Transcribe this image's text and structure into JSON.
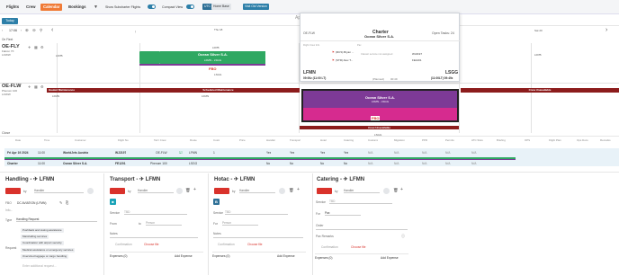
{
  "nav": {
    "tabs": [
      "Flights",
      "Crew",
      "Calendar",
      "Bookings"
    ],
    "active_tab": "Calendar",
    "show_subcharter_label": "Show Subcharter Flights",
    "compact_view_label": "Compact View",
    "utc_label": "UTC",
    "home_base_label": "Home Base",
    "old_version_label": "Visit Old Version"
  },
  "toolbar": {
    "today_label": "Today",
    "time_value": "17:06",
    "month_label": "Apr 2024",
    "on_fleet_label": "On Fleet",
    "day_left": "Thu 18",
    "day_right": "Sat 20",
    "hour_label": "07:00"
  },
  "aircraft": [
    {
      "reg": "OE-FLY",
      "type": "Falcon 7X",
      "base": "LOWW",
      "pax": "14"
    },
    {
      "reg": "OE-FLW",
      "type": "Phenom 100",
      "base": "LOWW",
      "pax": "4"
    }
  ],
  "timeline": {
    "row1": {
      "left_code": "LFPB",
      "bar_label": "Ocean Silver S.A.",
      "bar_sub": "LFMN - LSGG",
      "top_code": "LFPB",
      "fbo_label": "FBO",
      "below_code": "LSGG",
      "right_code": "LFPB",
      "right_small": "LFMN"
    },
    "row2": {
      "maint1": "Hauled Maintenance",
      "maint1_code": "LFMN",
      "maint2": "Scheduled Maintenance",
      "maint2_code": "LFMN",
      "bar_label": "Ocean Silver S.A.",
      "bar_sub": "LFMN - LSGG",
      "fbo_label": "FBO",
      "crew_label": "Crew Unavailable",
      "crew_code": "LSGG",
      "right_bar": "Crew Unavailable"
    }
  },
  "popup": {
    "reg": "OE-FLW",
    "type": "Charter",
    "customer": "Ocean Silver S.A.",
    "status": "Open Tasks: 24",
    "pic_label": "Flight Crew Info",
    "pic": "(RCS) Bryan ...",
    "sic": "(STR) Alex T...",
    "pax_label": "Pax",
    "no_pax": "Classic service not assigned",
    "from": "LFMN",
    "to": "LSGG",
    "dep_time": "09:00z (11:00 LT)",
    "arr_time": "(11:00LT) 09:49z",
    "flight_no": "WJ2197",
    "trip_no": "FE1201",
    "planned_label": "(Planned)",
    "duration": "00:49"
  },
  "close_label": "Close",
  "table": {
    "headers": [
      "Date",
      "Time",
      "Booking",
      "Customer",
      "Trip",
      "Flight No",
      "Tail / Crew",
      "A/C Type",
      "Route",
      "Pax",
      "Costs",
      "Price",
      "Handler",
      "Transport",
      "Hotel",
      "Catering",
      "Customs",
      "Migration",
      "PPR",
      "Permits",
      "ATC Slots",
      "Briefing",
      "OPS",
      "NOTAM",
      "Flight Plan",
      "Ops Docs",
      "Remarks"
    ],
    "rows": [
      {
        "date": "Fri Apr 19 2024",
        "time": "11:00",
        "customer": "WorldJets Austria",
        "flight_no": "WJ2197",
        "tail": "OE-FLW",
        "route": "LFMN",
        "pax": "1",
        "handler": "Yes",
        "transport": "Yes",
        "hotel": "Yes",
        "catering": "Yes",
        "customs": "N/A",
        "migration": "N/A",
        "ppr": "N/A",
        "permits": "N/A",
        "atc": "N/A"
      },
      {
        "date": "Charter",
        "time": "11:00",
        "customer": "Ocean Silver S.A.",
        "flight_no": "FE1201",
        "tail": "Phenom 100",
        "route": "LSGG",
        "pax": "",
        "handler": "No",
        "transport": "No",
        "hotel": "No",
        "catering": "No",
        "customs": "N/A",
        "migration": "N/A",
        "ppr": "N/A",
        "permits": "N/A",
        "atc": "N/A"
      }
    ]
  },
  "cards": [
    {
      "title": "Handling - ✈ LFMN",
      "by_label": "by",
      "by_value": "Handler",
      "fbo_label": "FBO",
      "fbo_value": "DC AVIATION (LFMN)",
      "info_label": "Info...",
      "type_label": "Type",
      "type_value": "Handling Request",
      "request_label": "Request",
      "chips": [
        "Pushback and towing assistance",
        "Marshalling services",
        "Coordination with airport security",
        "Medical assistance or emergency services",
        "Oversized luggage or cargo handling"
      ],
      "additional_placeholder": "Enter additional request..."
    },
    {
      "title": "Transport - ✈ LFMN",
      "by_label": "by",
      "by_value": "Handler",
      "service_label": "Service",
      "service_value": "TBD",
      "from_label": "From",
      "to_label": "to",
      "to_value": "Person",
      "notes_label": "Notes",
      "confirmation_label": "Confirmation",
      "choose_file": "Choose file",
      "expenses_label": "Expenses (0)",
      "add_expense": "Add Expense"
    },
    {
      "title": "Hotac - ✈ LFMN",
      "by_label": "by",
      "by_value": "Handler",
      "service_label": "Service",
      "service_value": "TBD",
      "for_label": "For",
      "for_value": "Person",
      "notes_label": "Notes",
      "confirmation_label": "Confirmation",
      "choose_file": "Choose file",
      "expenses_label": "Expenses (0)",
      "add_expense": "Add Expense"
    },
    {
      "title": "Catering - ✈ LFMN",
      "by_label": "by",
      "by_value": "Handler",
      "service_label": "Service",
      "service_value": "TBD",
      "for_label": "For",
      "for_value": "Pax",
      "order_label": "Order",
      "remarks_label": "Pax Remarks",
      "confirmation_label": "Confirmation",
      "choose_file": "Choose file",
      "expenses_label": "Expenses (0)",
      "add_expense": "Add Expense"
    }
  ],
  "colors": {
    "accent": "#f07a36",
    "brand_blue": "#2d7fa8",
    "green": "#2fa862",
    "purple": "#7d3a96",
    "maint_red": "#8c1c1c",
    "danger": "#d9322b"
  }
}
